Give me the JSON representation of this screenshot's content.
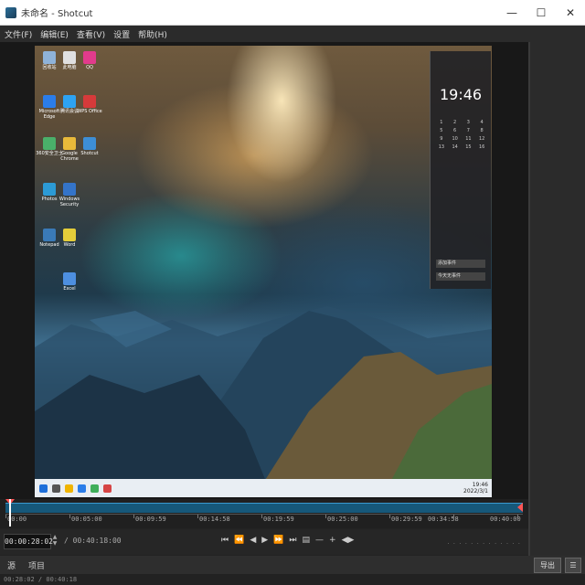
{
  "window": {
    "title": "未命名 - Shotcut",
    "minimize": "—",
    "maximize": "☐",
    "close": "✕"
  },
  "menu": [
    "文件(F)",
    "编辑(E)",
    "查看(V)",
    "设置",
    "帮助(H)"
  ],
  "desktop": {
    "icons": [
      "回收站",
      "此电脑",
      "QQ",
      "Microsoft Edge",
      "腾讯会议",
      "WPS Office",
      "360安全卫士",
      "Google Chrome",
      "Shotcut",
      "Photos",
      "Windows Security",
      "Notepad",
      "Word",
      "Excel"
    ],
    "calendar_time": "19:46",
    "calendar_buttons": [
      "添加事件",
      "今天无事件"
    ],
    "taskbar_clock_line1": "19:46",
    "taskbar_clock_line2": "2022/3/1"
  },
  "timeline": {
    "ticks": [
      "00:00",
      "00:05:00",
      "00:09:59",
      "00:14:58",
      "00:19:59",
      "00:25:00",
      "00:29:59",
      "00:34:58",
      "00:40:00"
    ]
  },
  "player": {
    "timecode": "00:00:28:02",
    "duration": "/ 00:40:18:00",
    "transport": [
      "⏮",
      "⏪",
      "◀",
      "▶",
      "⏩",
      "⏭",
      "▤",
      "—",
      "+",
      "◀▶"
    ]
  },
  "tabs": {
    "source": "源",
    "project": "项目",
    "export": "导出",
    "menu": "☰"
  },
  "status": "00:28:02 / 00:40:18",
  "colors": {
    "accent": "#16587a",
    "marker": "#ff5555"
  }
}
